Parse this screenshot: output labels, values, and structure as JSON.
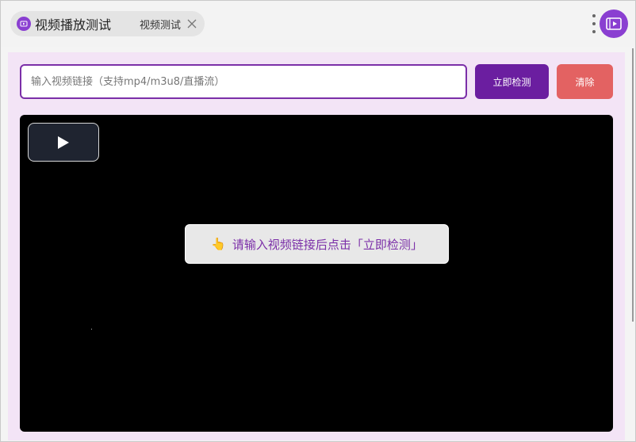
{
  "header": {
    "app_title": "视频播放测试",
    "tab_label": "视频测试"
  },
  "form": {
    "url_placeholder": "输入视频链接（支持mp4/m3u8/直播流）",
    "url_value": "",
    "check_label": "立即检测",
    "clear_label": "清除"
  },
  "player": {
    "hint_icon": "👆",
    "hint_text": "请输入视频链接后点击「立即检测」"
  },
  "icons": {
    "app": "video-app-icon",
    "close": "close-icon",
    "more": "more-vertical-icon",
    "play": "play-icon"
  },
  "colors": {
    "accent": "#7b2fa8",
    "primary_button": "#6b1ea0",
    "danger_button": "#e36262",
    "panel_bg": "#f3e4f6"
  }
}
